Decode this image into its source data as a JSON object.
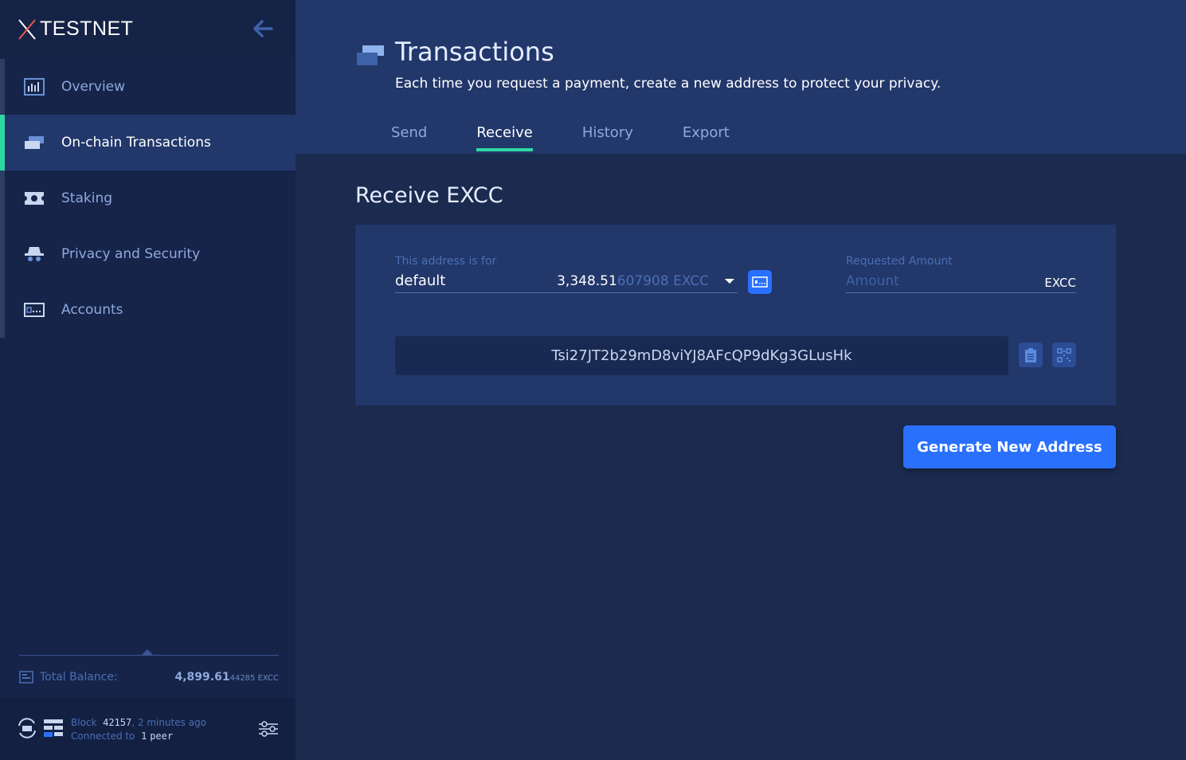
{
  "app": {
    "logo_text": "TESTNET"
  },
  "sidebar": {
    "items": [
      {
        "label": "Overview",
        "icon": "overview-chart-icon"
      },
      {
        "label": "On-chain Transactions",
        "icon": "transactions-icon",
        "active": true
      },
      {
        "label": "Staking",
        "icon": "ticket-icon"
      },
      {
        "label": "Privacy and Security",
        "icon": "spy-hat-icon"
      },
      {
        "label": "Accounts",
        "icon": "accounts-card-icon"
      }
    ],
    "balance": {
      "label": "Total Balance:",
      "value_main": "4,899.61",
      "value_small": "44285 EXCC"
    },
    "status": {
      "block_label": "Block",
      "block_number": "42157",
      "block_time": ", 2 minutes ago",
      "connected_label": "Connected to",
      "peer_count": "1",
      "peer_label": "peer"
    }
  },
  "header": {
    "title": "Transactions",
    "subtitle": "Each time you request a payment, create a new address to protect your privacy.",
    "tabs": [
      {
        "label": "Send"
      },
      {
        "label": "Receive",
        "active": true
      },
      {
        "label": "History"
      },
      {
        "label": "Export"
      }
    ]
  },
  "receive": {
    "title": "Receive EXCC",
    "account_label": "This address is for",
    "account_name": "default",
    "account_balance_main": "3,348.51",
    "account_balance_dim": "607908 EXCC",
    "amount_label": "Requested Amount",
    "amount_placeholder": "Amount",
    "amount_unit": "EXCC",
    "address": "Tsi27JT2b29mD8viYJ8AFcQP9dKg3GLusHk",
    "generate_label": "Generate New Address"
  },
  "colors": {
    "accent": "#2ed8a3",
    "primary_button": "#2970ff",
    "sidebar_bg": "#16244a",
    "main_bg": "#1b2a4f",
    "header_bg": "#22376a"
  }
}
